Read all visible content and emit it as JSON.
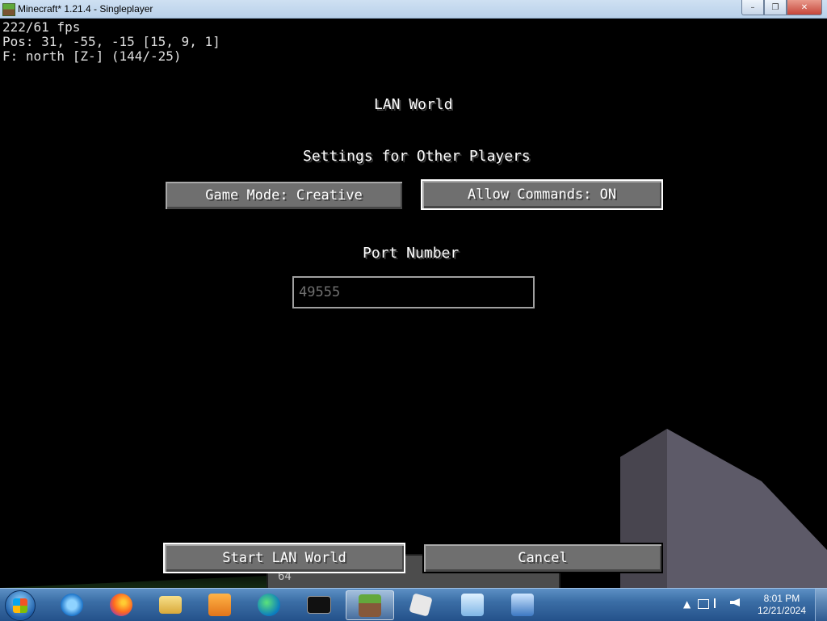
{
  "window": {
    "title": "Minecraft* 1.21.4 - Singleplayer",
    "minimize_label": "–",
    "maximize_label": "❐",
    "close_label": "✕"
  },
  "debug": {
    "fps": "222/61 fps",
    "pos": "Pos: 31, -55, -15 [15, 9, 1]",
    "facing": "F: north [Z-] (144/-25)"
  },
  "screen": {
    "title": "LAN World",
    "settings_heading": "Settings for Other Players",
    "game_mode_button": "Game Mode: Creative",
    "allow_commands_button": "Allow Commands: ON",
    "port_label": "Port Number",
    "port_value": "49555",
    "start_button": "Start LAN World",
    "cancel_button": "Cancel"
  },
  "hud": {
    "level": "64"
  },
  "taskbar": {
    "apps": [
      {
        "icon": "internet-explorer-icon"
      },
      {
        "icon": "firefox-icon"
      },
      {
        "icon": "file-explorer-icon"
      },
      {
        "icon": "media-player-icon"
      },
      {
        "icon": "edge-icon"
      },
      {
        "icon": "command-prompt-icon"
      },
      {
        "icon": "minecraft-icon"
      },
      {
        "icon": "roblox-icon"
      },
      {
        "icon": "control-panel-icon"
      },
      {
        "icon": "remote-desktop-icon"
      }
    ],
    "tray_arrow": "▲",
    "time": "8:01 PM",
    "date": "12/21/2024"
  }
}
